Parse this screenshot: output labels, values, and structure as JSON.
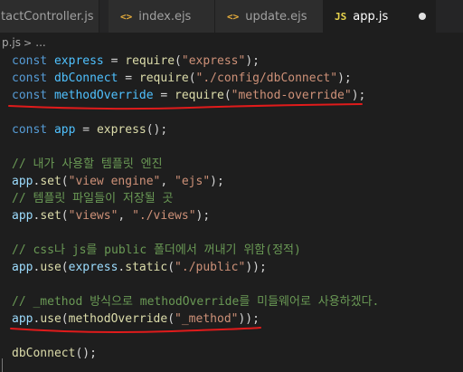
{
  "tabs": [
    {
      "label": "tactController.js",
      "icon": "",
      "active": false
    },
    {
      "label": "index.ejs",
      "icon": "<>",
      "active": false
    },
    {
      "label": "update.ejs",
      "icon": "<>",
      "active": false
    },
    {
      "label": "app.js",
      "icon": "JS",
      "active": true
    }
  ],
  "breadcrumb": {
    "file": "p.js",
    "separator": ">",
    "ellipsis": "..."
  },
  "code": {
    "l1": {
      "kw": "const",
      "name": "express",
      "eq": " = ",
      "fn": "require",
      "open": "(",
      "str": "\"express\"",
      "close": ");"
    },
    "l2": {
      "kw": "const",
      "name": "dbConnect",
      "eq": " = ",
      "fn": "require",
      "open": "(",
      "str": "\"./config/dbConnect\"",
      "close": ");"
    },
    "l3": {
      "kw": "const",
      "name": "methodOverride",
      "eq": " = ",
      "fn": "require",
      "open": "(",
      "str": "\"method-override\"",
      "close": ");"
    },
    "l5": {
      "kw": "const",
      "name": "app",
      "eq": " = ",
      "fn": "express",
      "close": "();"
    },
    "l7": {
      "text": "// 내가 사용할 템플릿 엔진"
    },
    "l8": {
      "obj": "app",
      "dot": ".",
      "fn": "set",
      "open": "(",
      "s1": "\"view engine\"",
      "comma": ", ",
      "s2": "\"ejs\"",
      "close": ");"
    },
    "l9": {
      "text": "// 템플릿 파일들이 저장될 곳"
    },
    "l10": {
      "obj": "app",
      "dot": ".",
      "fn": "set",
      "open": "(",
      "s1": "\"views\"",
      "comma": ", ",
      "s2": "\"./views\"",
      "close": ");"
    },
    "l12": {
      "text": "// css나 js를 public 폴더에서 꺼내기 위함(정적)"
    },
    "l13": {
      "obj": "app",
      "dot": ".",
      "fn": "use",
      "open": "(",
      "obj2": "express",
      "dot2": ".",
      "fn2": "static",
      "open2": "(",
      "s1": "\"./public\"",
      "close": "));"
    },
    "l15": {
      "text": "// _method 방식으로 methodOverride를 미들웨어로 사용하겠다."
    },
    "l16": {
      "obj": "app",
      "dot": ".",
      "fn": "use",
      "open": "(",
      "fn2": "methodOverride",
      "open2": "(",
      "s1": "\"_method\"",
      "close": "));"
    },
    "l18": {
      "fn": "dbConnect",
      "close": "();"
    }
  },
  "colors": {
    "annotation": "#e01b1b",
    "keyword": "#569cd6",
    "string": "#ce9178",
    "comment": "#6a9955",
    "function": "#dcdcaa"
  }
}
